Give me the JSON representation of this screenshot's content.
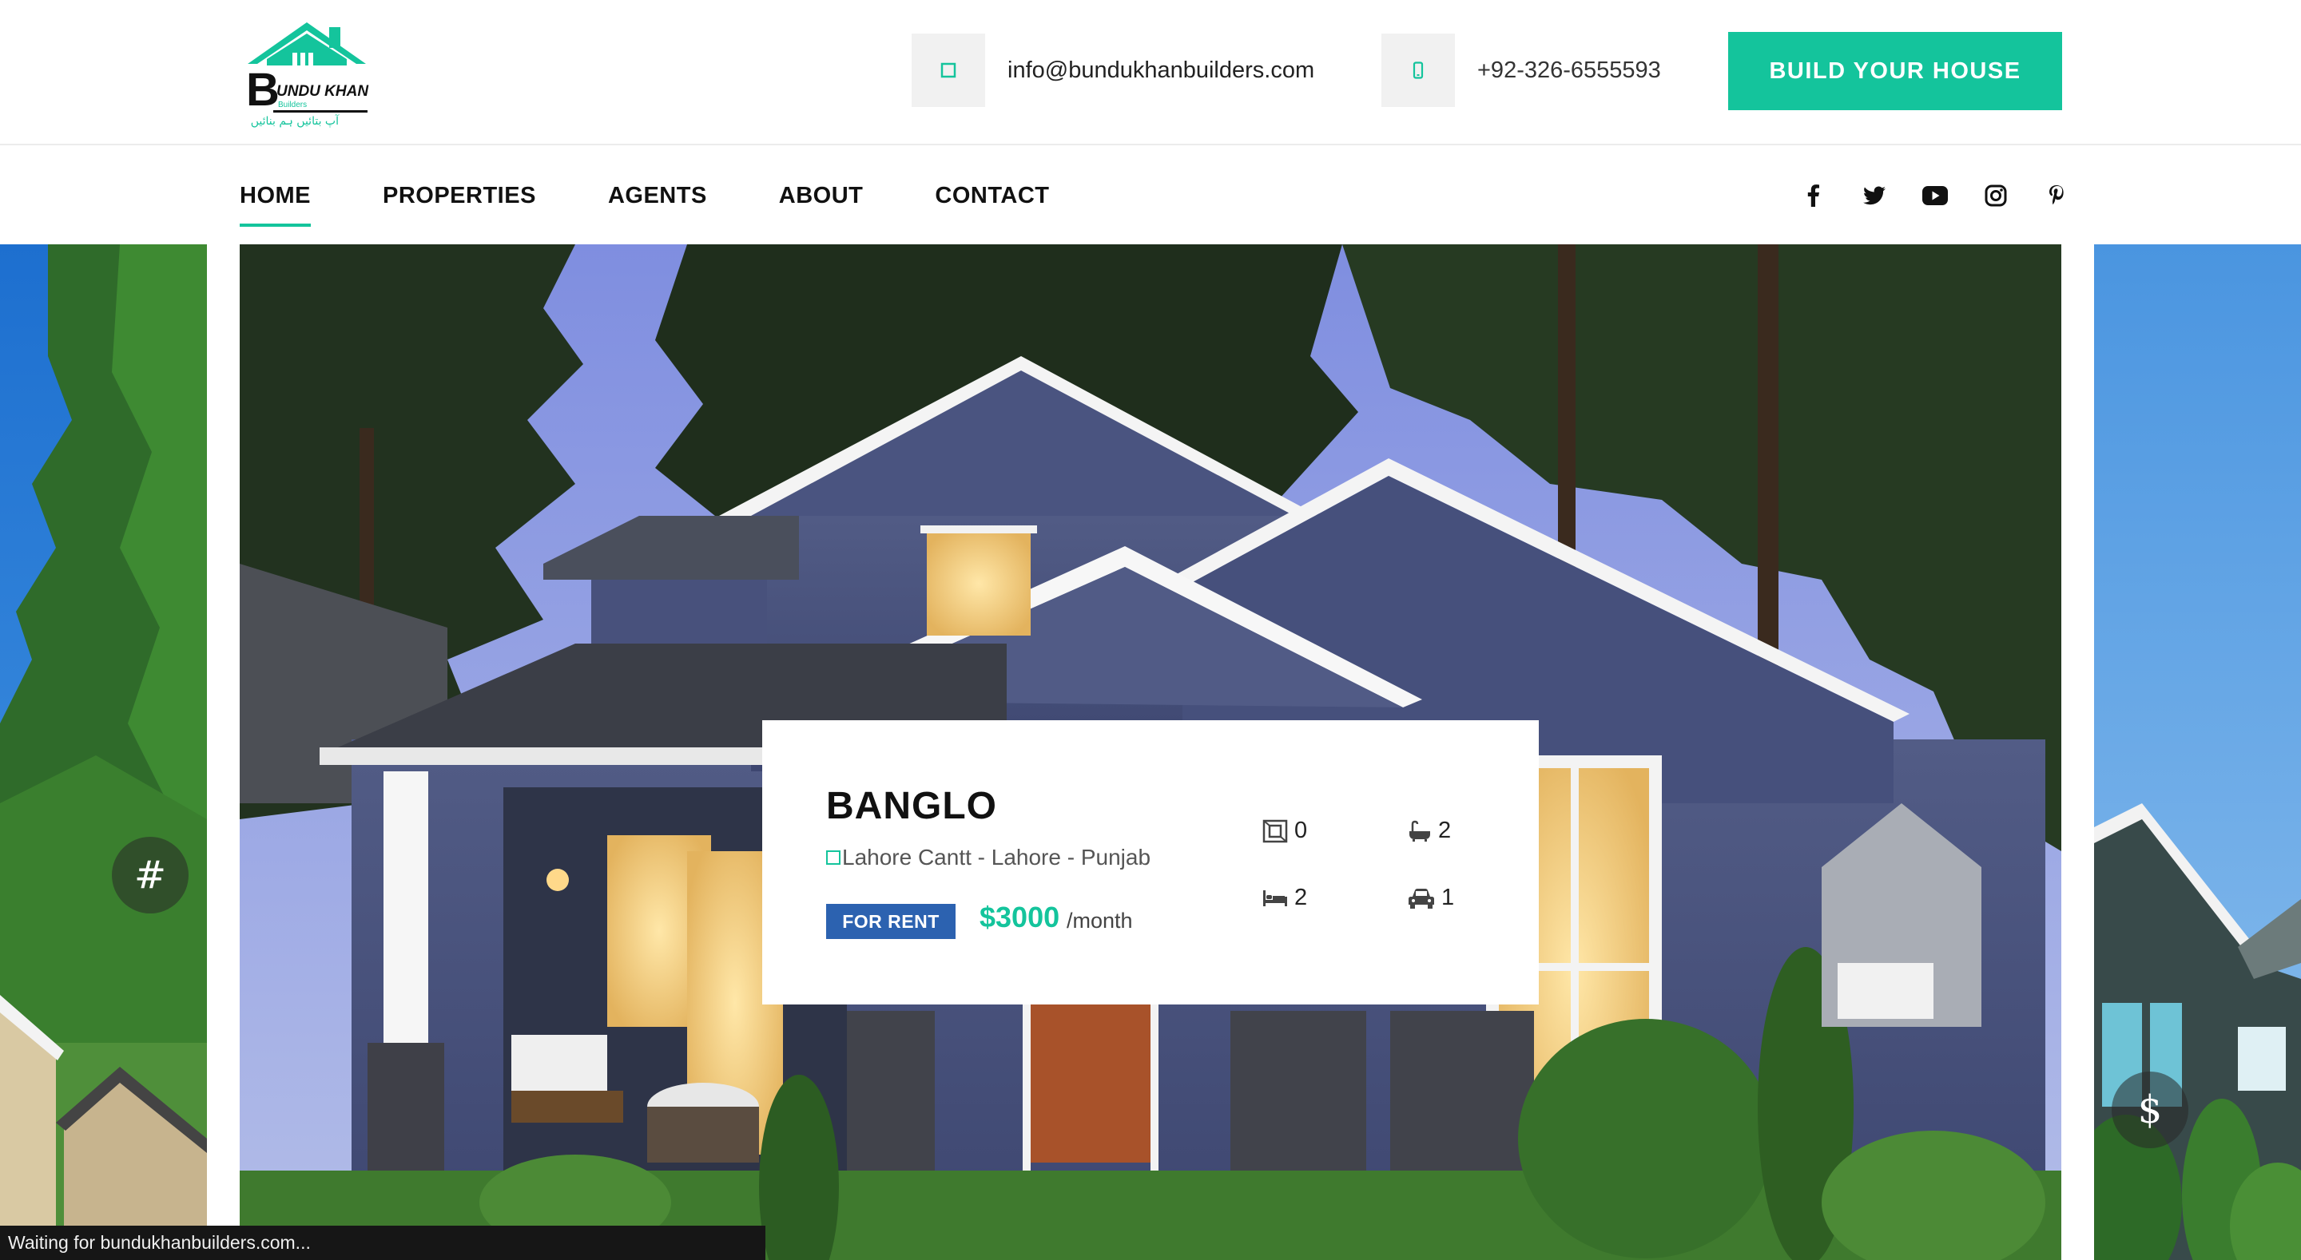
{
  "brand": {
    "logo_name": "BUNDU KHAN",
    "logo_sub": "Builders",
    "logo_tagline": "آپ بتائیں ہم بنائیں"
  },
  "topbar": {
    "email": {
      "icon": "envelope-icon",
      "text": "info@bundukhanbuilders.com"
    },
    "phone": {
      "icon": "mobile-phone-icon",
      "text": "+92-326-6555593"
    },
    "cta_label": "BUILD YOUR HOUSE"
  },
  "nav": {
    "items": [
      {
        "label": "HOME",
        "active": true
      },
      {
        "label": "PROPERTIES",
        "active": false
      },
      {
        "label": "AGENTS",
        "active": false
      },
      {
        "label": "ABOUT",
        "active": false
      },
      {
        "label": "CONTACT",
        "active": false
      }
    ],
    "socials": [
      "facebook-icon",
      "twitter-icon",
      "youtube-icon",
      "instagram-icon",
      "pinterest-icon"
    ]
  },
  "slider": {
    "prev_glyph": "#",
    "next_glyph": "$"
  },
  "property": {
    "title": "BANGLO",
    "location": "Lahore Cantt - Lahore - Punjab",
    "status": "FOR RENT",
    "price": "$3000",
    "period": "/month",
    "features": {
      "area": "0",
      "baths": "2",
      "beds": "2",
      "garages": "1"
    }
  },
  "browser": {
    "status_text": "Waiting for bundukhanbuilders.com..."
  },
  "colors": {
    "accent": "#14c49c",
    "badge": "#2c62b0",
    "status_bar": "#161616"
  }
}
